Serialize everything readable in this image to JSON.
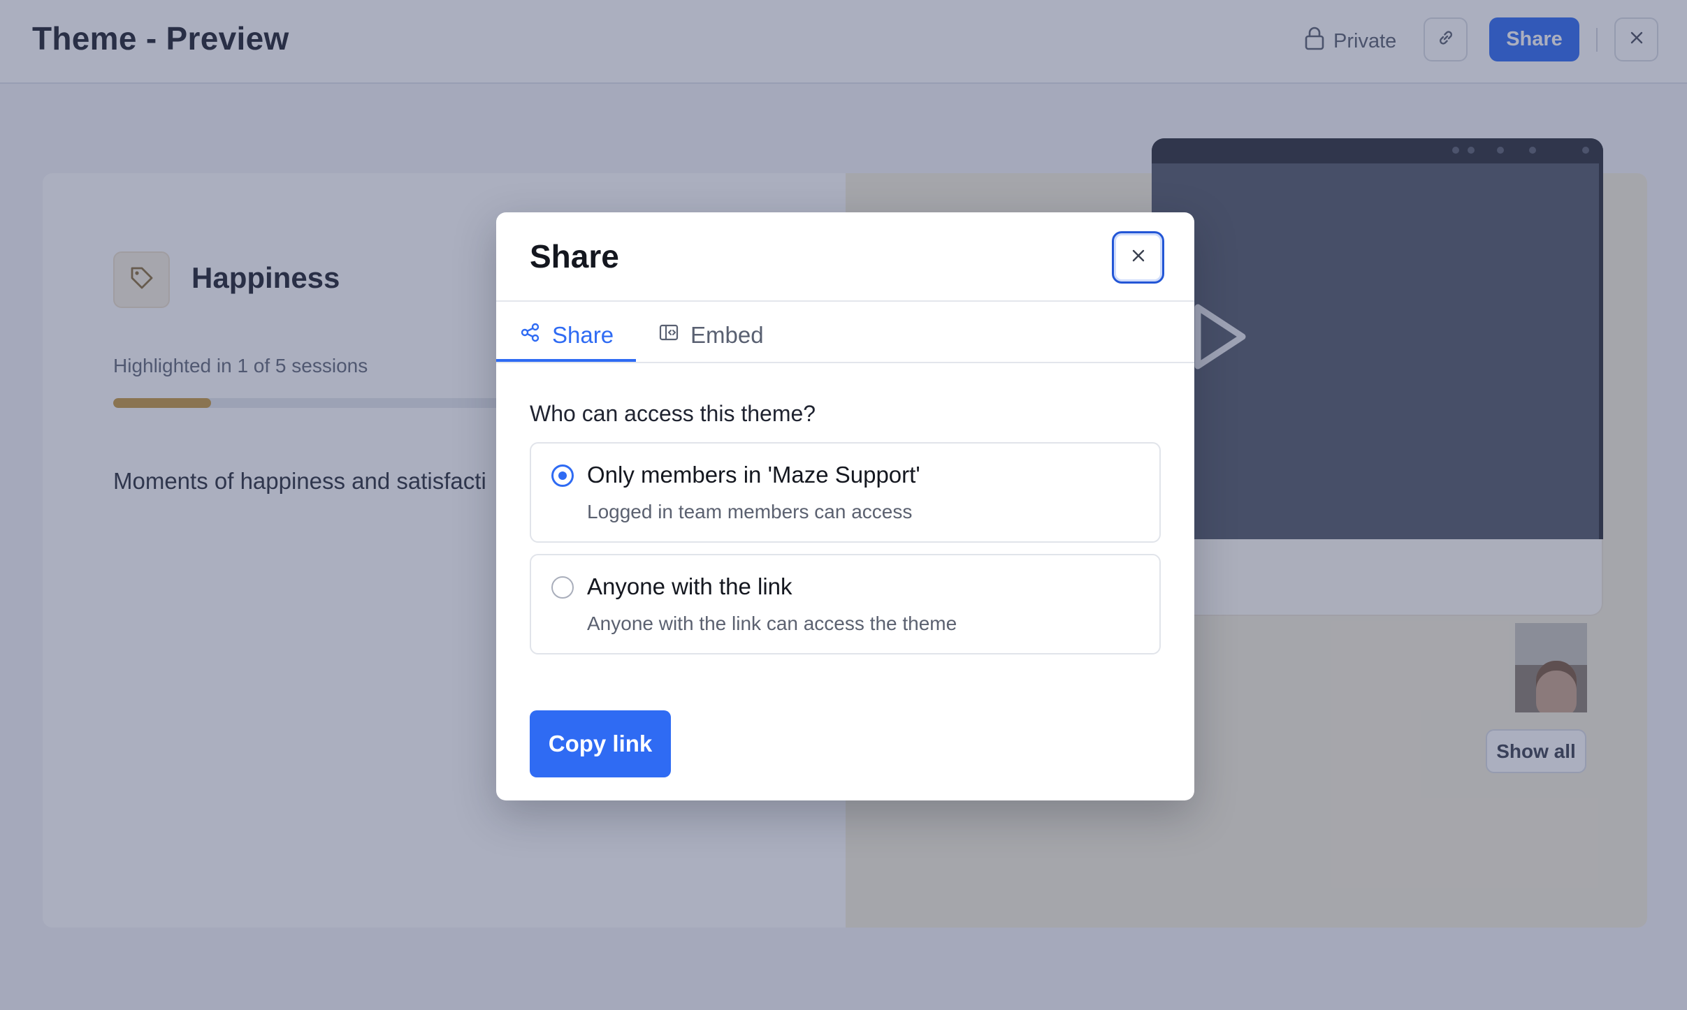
{
  "header": {
    "title": "Theme - Preview",
    "privacy_label": "Private",
    "share_label": "Share"
  },
  "theme": {
    "name": "Happiness",
    "highlighted_text": "Highlighted in 1 of 5 sessions",
    "sessions_highlighted_fraction": 0.2,
    "description": "Moments of happiness and satisfacti",
    "show_all_label": "Show all"
  },
  "modal": {
    "title": "Share",
    "tabs": [
      {
        "label": "Share",
        "icon": "share-icon",
        "active": true
      },
      {
        "label": "Embed",
        "icon": "embed-icon",
        "active": false
      }
    ],
    "question": "Who can access this theme?",
    "options": [
      {
        "label": "Only members in 'Maze Support'",
        "description": "Logged in team members can access",
        "selected": true
      },
      {
        "label": "Anyone with the link",
        "description": "Anyone with the link can access the theme",
        "selected": false
      }
    ],
    "copy_link_label": "Copy link"
  },
  "colors": {
    "accent": "#2f6bf3",
    "progress": "#c69a43",
    "overlay": "rgba(56, 64, 102, 0.42)"
  }
}
